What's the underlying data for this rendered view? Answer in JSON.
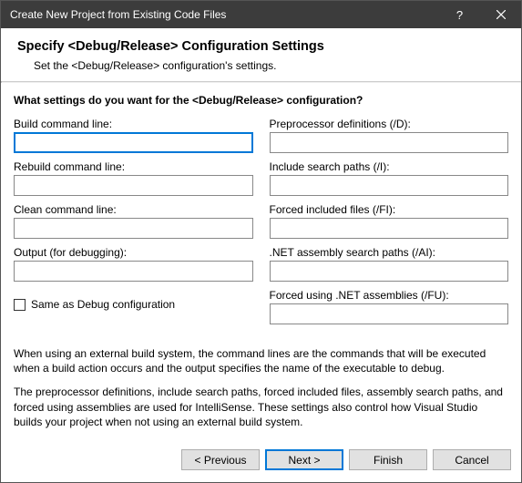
{
  "window": {
    "title": "Create New Project from Existing Code Files"
  },
  "header": {
    "title": "Specify <Debug/Release> Configuration Settings",
    "subtitle": "Set the <Debug/Release> configuration's settings."
  },
  "question": "What settings do you want for the <Debug/Release> configuration?",
  "left": {
    "build": {
      "label": "Build command line:",
      "value": ""
    },
    "rebuild": {
      "label": "Rebuild command line:",
      "value": ""
    },
    "clean": {
      "label": "Clean command line:",
      "value": ""
    },
    "output": {
      "label": "Output (for debugging):",
      "value": ""
    }
  },
  "right": {
    "preproc": {
      "label": "Preprocessor definitions (/D):",
      "value": ""
    },
    "include": {
      "label": "Include search paths (/I):",
      "value": ""
    },
    "forcedinc": {
      "label": "Forced included files (/FI):",
      "value": ""
    },
    "asmsearch": {
      "label": ".NET assembly search paths (/AI):",
      "value": ""
    },
    "forcedusing": {
      "label": "Forced using .NET assemblies (/FU):",
      "value": ""
    }
  },
  "checkbox": {
    "label": "Same as Debug configuration"
  },
  "description": {
    "p1": "When using an external build system, the command lines are the commands that will be executed when a build action occurs and the output specifies the name of the executable to debug.",
    "p2": "The preprocessor definitions, include search paths, forced included files, assembly search paths, and forced using assemblies are used for IntelliSense.  These settings also control how Visual Studio builds your project when not using an external build system."
  },
  "buttons": {
    "previous": "< Previous",
    "next": "Next >",
    "finish": "Finish",
    "cancel": "Cancel"
  }
}
